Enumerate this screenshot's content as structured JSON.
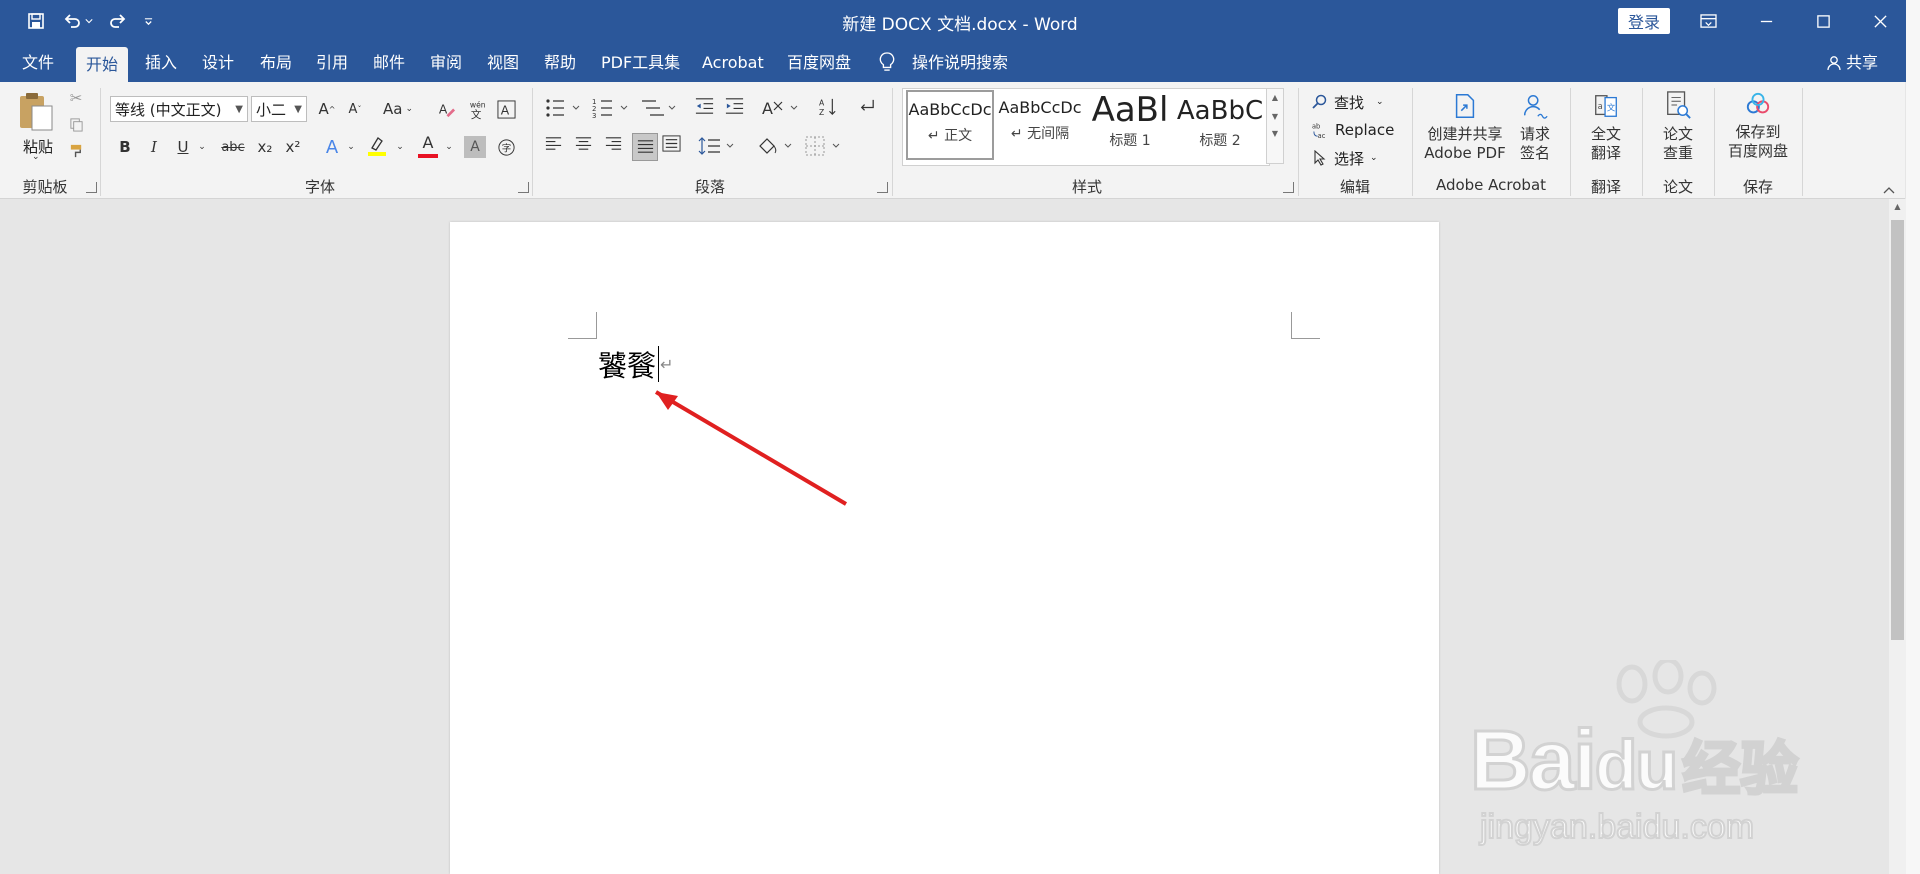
{
  "window": {
    "title": "新建 DOCX 文档.docx  -  Word",
    "login": "登录"
  },
  "tabs": [
    "文件",
    "开始",
    "插入",
    "设计",
    "布局",
    "引用",
    "邮件",
    "审阅",
    "视图",
    "帮助",
    "PDF工具集",
    "Acrobat",
    "百度网盘"
  ],
  "active_tab": "开始",
  "tell_me": "操作说明搜索",
  "share": "共享",
  "clipboard": {
    "paste": "粘贴",
    "label": "剪贴板"
  },
  "font": {
    "name": "等线 (中文正文)",
    "size": "小二",
    "label": "字体",
    "grow": "A",
    "shrink": "A",
    "case": "Aa",
    "bold": "B",
    "italic": "I",
    "underline": "U",
    "strike": "abc",
    "sub": "x₂",
    "sup": "x²",
    "color_glyph": "A",
    "font_color": "#e81123",
    "highlight_color": "#ffff00"
  },
  "paragraph": {
    "label": "段落"
  },
  "styles": {
    "label": "样式",
    "items": [
      {
        "sample": "AaBbCcDc",
        "name": "↵ 正文"
      },
      {
        "sample": "AaBbCcDc",
        "name": "↵ 无间隔"
      },
      {
        "sample": "AaBl",
        "name": "标题 1"
      },
      {
        "sample": "AaBbC",
        "name": "标题 2"
      }
    ]
  },
  "editing": {
    "find": "查找",
    "replace": "Replace",
    "select": "选择",
    "label": "编辑"
  },
  "acrobat": {
    "create": [
      "创建并共享",
      "Adobe PDF"
    ],
    "sign": [
      "请求",
      "签名"
    ],
    "label": "Adobe Acrobat"
  },
  "translate": {
    "btn": [
      "全文",
      "翻译"
    ],
    "label": "翻译"
  },
  "paper": {
    "btn": [
      "论文",
      "查重"
    ],
    "label": "论文"
  },
  "save": {
    "btn": [
      "保存到",
      "百度网盘"
    ],
    "label": "保存"
  },
  "document": {
    "text": "饕餮",
    "para_mark": "↵"
  },
  "watermark": {
    "brand": "Bai",
    "du": "du",
    "cn": "经验",
    "url": "jingyan.baidu.com"
  },
  "colors": {
    "brand": "#2b579a",
    "arrow": "#e02020"
  }
}
